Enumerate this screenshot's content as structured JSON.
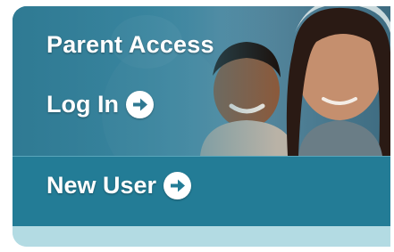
{
  "panel": {
    "title": "Parent Access",
    "login_label": "Log In",
    "new_user_label": "New User"
  },
  "icons": {
    "login_arrow": "arrow-right-circle",
    "new_user_arrow": "arrow-right-circle"
  },
  "colors": {
    "panel_blue": "#237c96",
    "photo_blue": "#3b87a0",
    "bottom_strip": "#b3dbe3",
    "text": "#ffffff"
  }
}
